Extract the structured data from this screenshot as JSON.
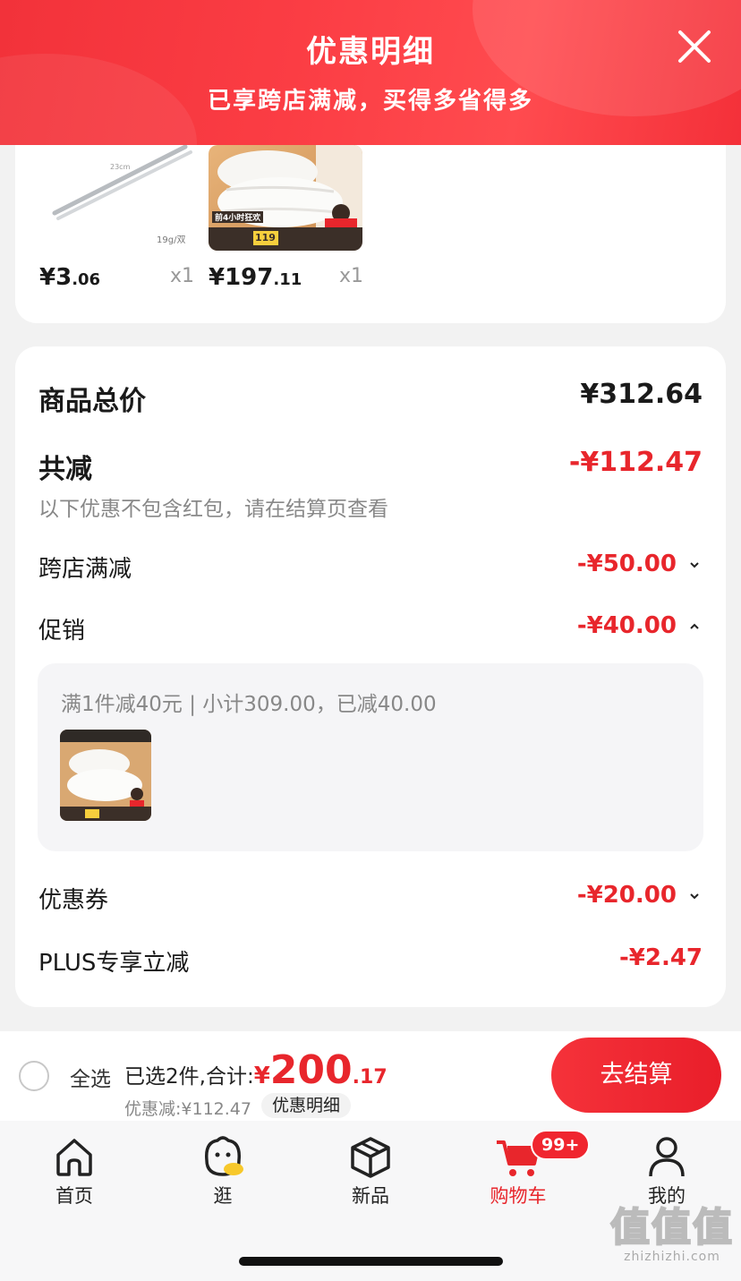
{
  "header": {
    "title": "优惠明细",
    "subtitle": "已享跨店满减，买得多省得多"
  },
  "products": [
    {
      "price_int": "¥3",
      "price_dec": ".06",
      "qty": "x1",
      "img_note": "19g/双",
      "img_label": "23cm"
    },
    {
      "price_int": "¥197",
      "price_dec": ".11",
      "qty": "x1",
      "img_badge": "前4小时狂欢",
      "img_price": "119"
    }
  ],
  "summary": {
    "total_label": "商品总价",
    "total_value": "¥312.64",
    "reduce_label": "共减",
    "reduce_value": "-¥112.47",
    "reduce_note": "以下优惠不包含红包，请在结算页查看",
    "cross_store_label": "跨店满减",
    "cross_store_value": "-¥50.00",
    "promo_label": "促销",
    "promo_value": "-¥40.00",
    "promo_detail": "满1件减40元 | 小计309.00，已减40.00",
    "coupon_label": "优惠券",
    "coupon_value": "-¥20.00",
    "plus_label": "PLUS专享立减",
    "plus_value": "-¥2.47"
  },
  "checkout": {
    "select_all": "全选",
    "selected_text": "已选2件,合计:",
    "total_yen": "¥",
    "total_int": "200",
    "total_dec": ".17",
    "discount_text": "优惠减:¥112.47",
    "detail_chip": "优惠明细",
    "checkout_button": "去结算"
  },
  "tabs": [
    {
      "label": "首页",
      "icon": "home-icon"
    },
    {
      "label": "逛",
      "icon": "browse-mascot-icon"
    },
    {
      "label": "新品",
      "icon": "box-icon"
    },
    {
      "label": "购物车",
      "icon": "cart-icon",
      "badge": "99+",
      "active": true
    },
    {
      "label": "我的",
      "icon": "person-icon"
    }
  ],
  "watermark": {
    "big": "值值值",
    "small": "zhizhizhi.com"
  },
  "colors": {
    "accent": "#e8262c",
    "header": "#f7383f"
  }
}
